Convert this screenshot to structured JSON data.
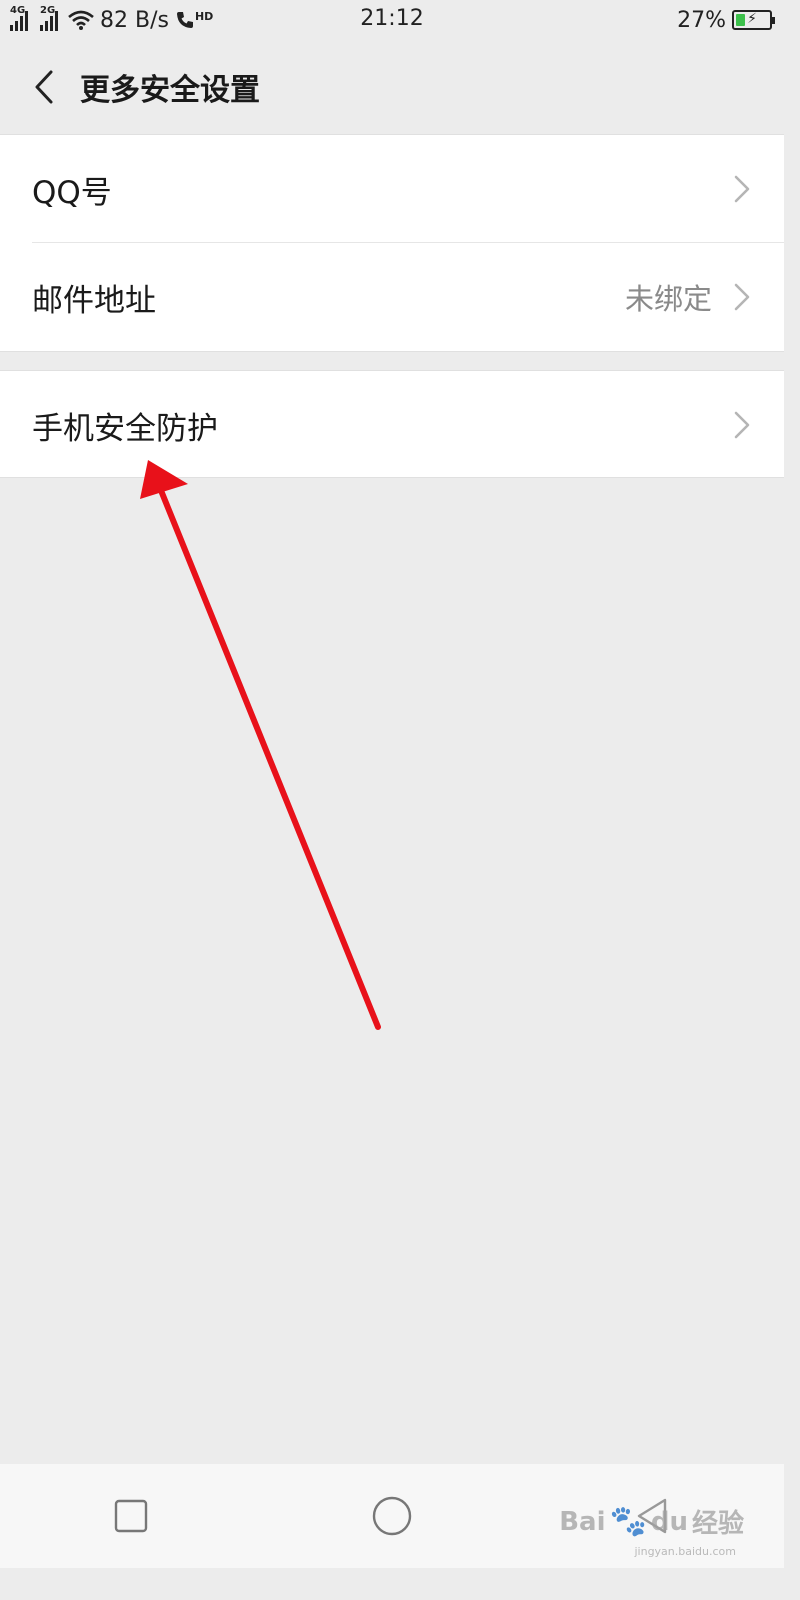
{
  "status_bar": {
    "net1": "4G",
    "net2": "2G",
    "speed": "82 B/s",
    "hd": "HD",
    "time": "21:12",
    "battery": "27%",
    "battery_level": 0.27
  },
  "header": {
    "title": "更多安全设置"
  },
  "settings": {
    "qq_label": "QQ号",
    "email_label": "邮件地址",
    "email_value": "未绑定",
    "protect_label": "手机安全防护"
  },
  "watermark": {
    "brand_left": "Bai",
    "brand_mid": "du",
    "brand_right": "经验",
    "url": "jingyan.baidu.com"
  },
  "colors": {
    "annotation": "#e8111a",
    "background": "#ececec",
    "battery_fill": "#3cc04b"
  }
}
